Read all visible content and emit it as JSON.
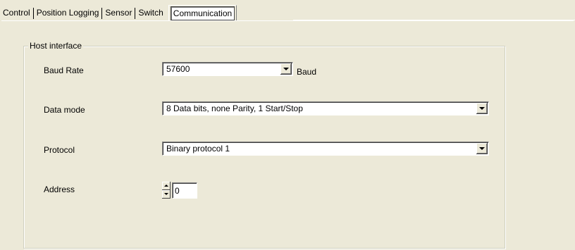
{
  "tabs": [
    {
      "label": "Control"
    },
    {
      "label": "Position Logging"
    },
    {
      "label": "Sensor"
    },
    {
      "label": "Switch"
    },
    {
      "label": "Communication",
      "active": true
    }
  ],
  "group": {
    "title": "Host interface"
  },
  "fields": {
    "baud_rate": {
      "label": "Baud Rate",
      "value": "57600",
      "unit": "Baud"
    },
    "data_mode": {
      "label": "Data mode",
      "value": "8 Data bits, none Parity, 1 Start/Stop"
    },
    "protocol": {
      "label": "Protocol",
      "value": "Binary protocol 1"
    },
    "address": {
      "label": "Address",
      "value": "0"
    }
  },
  "colors": {
    "background": "#ece9d8",
    "field_background": "#ffffff"
  },
  "icons": {
    "combo_arrow": "chevron-down-icon",
    "spin_up": "arrow-up-icon",
    "spin_down": "arrow-down-icon"
  }
}
